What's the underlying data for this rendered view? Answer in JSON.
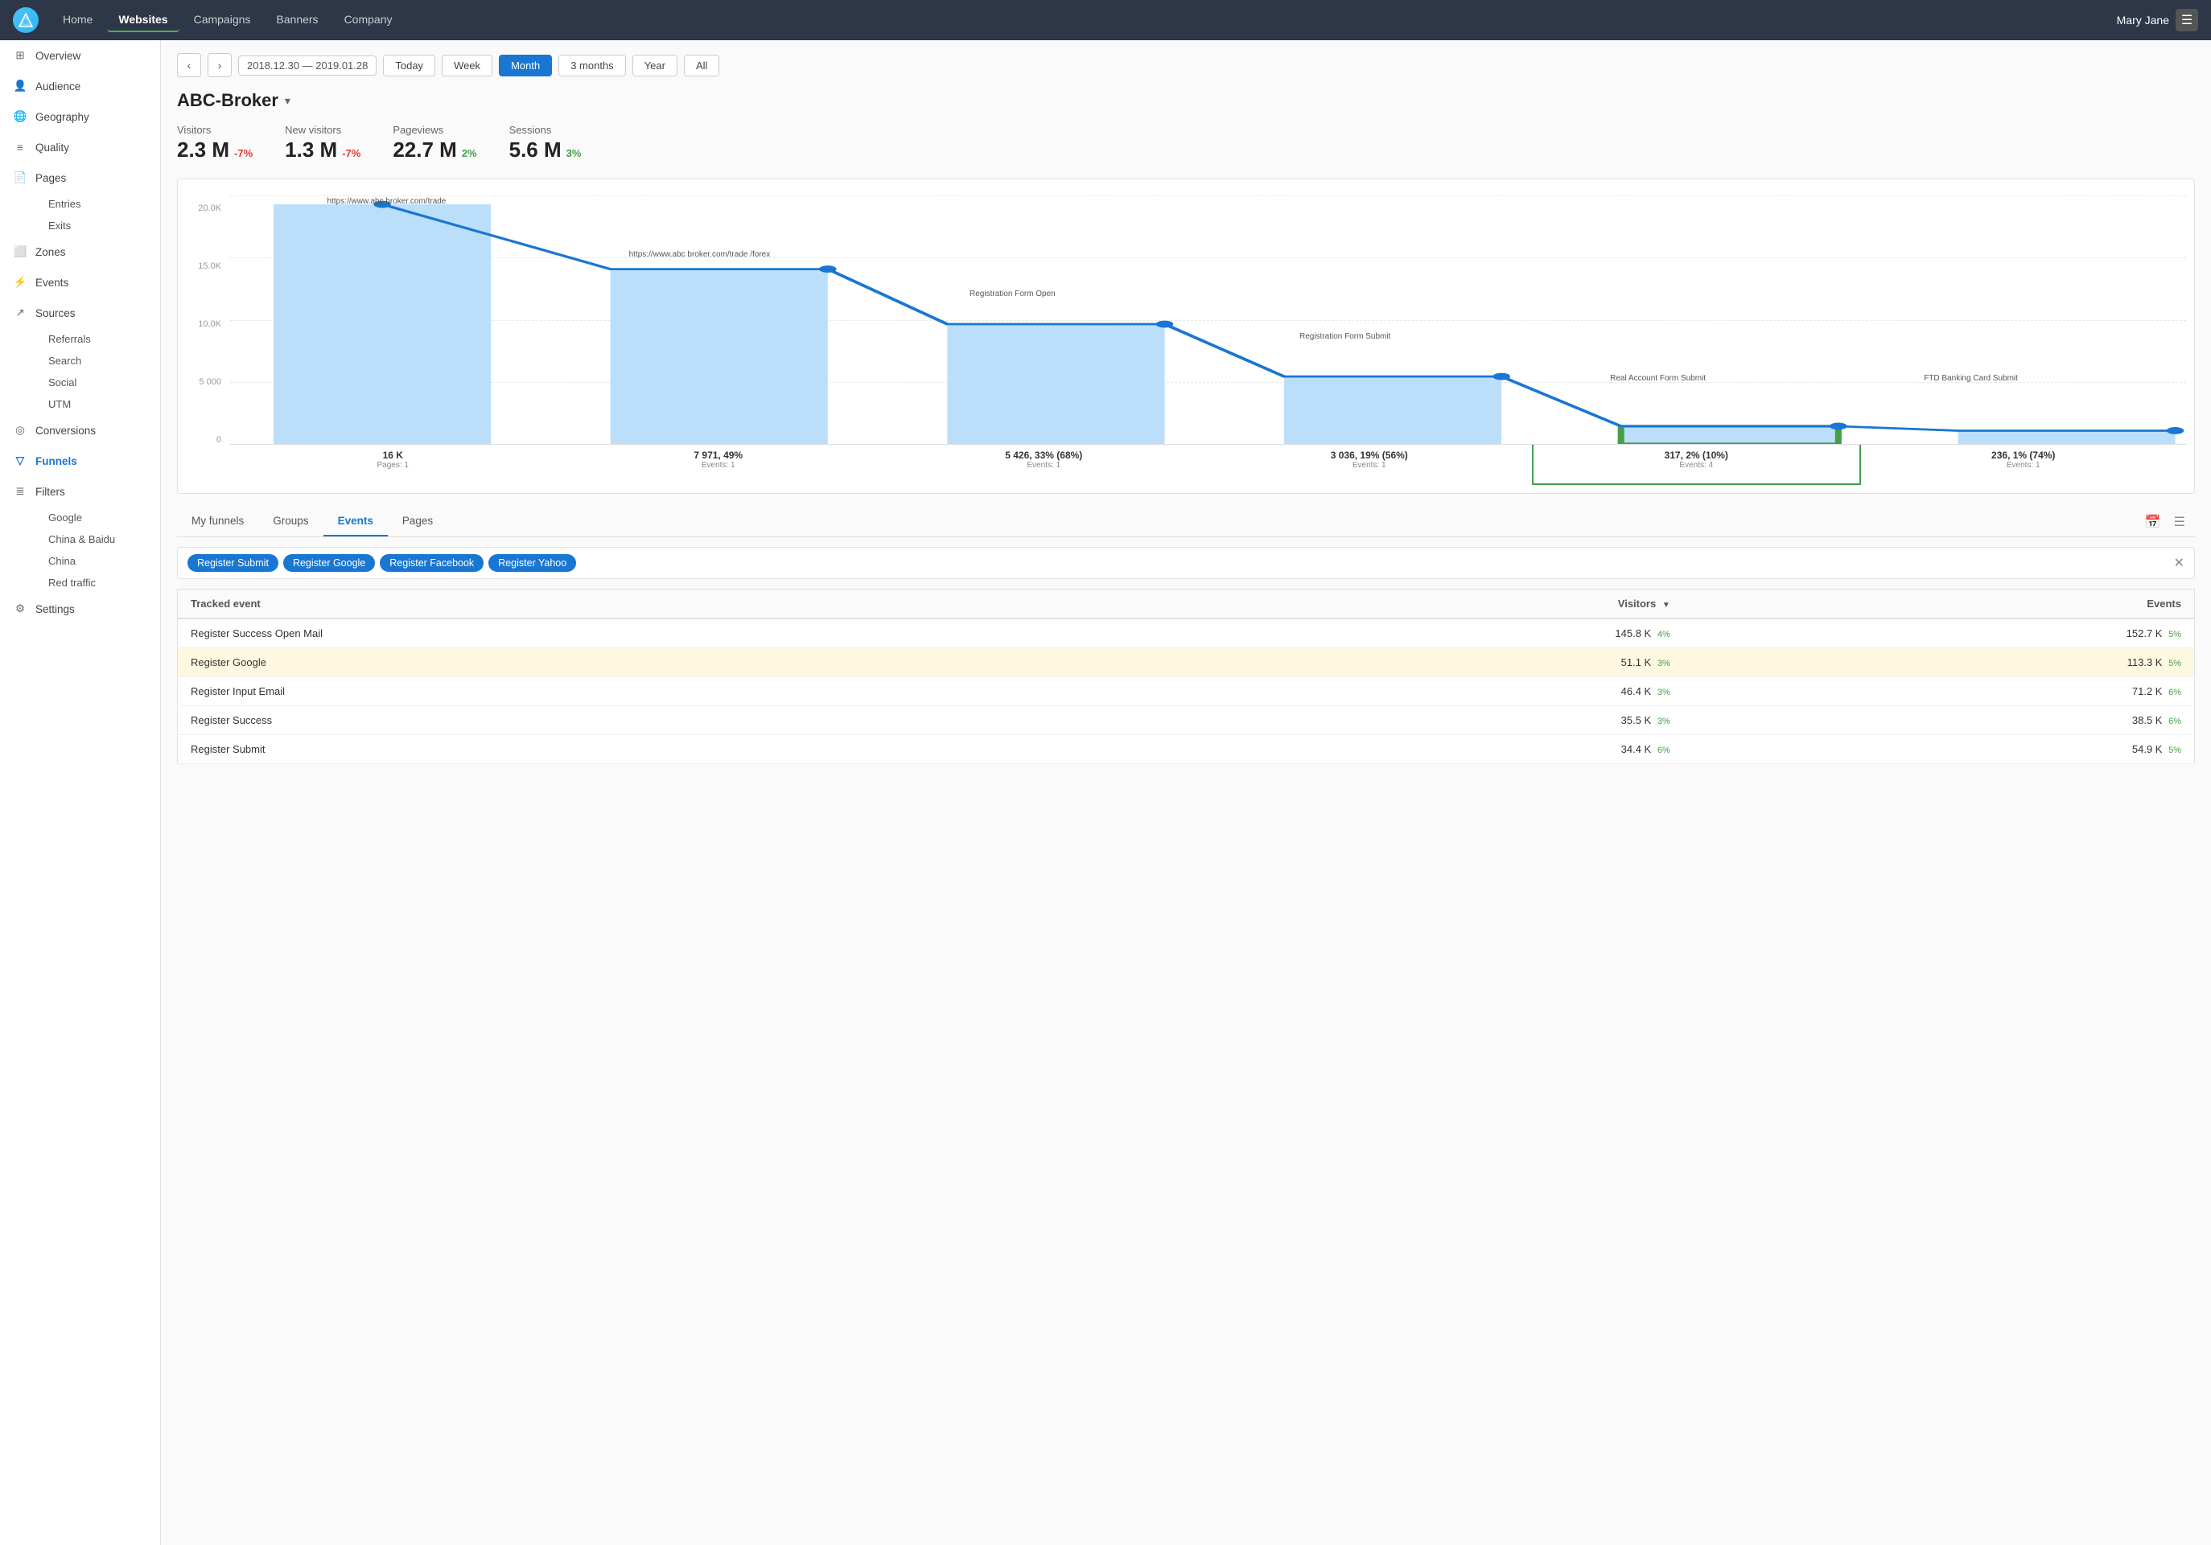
{
  "topNav": {
    "links": [
      {
        "label": "Home",
        "active": false
      },
      {
        "label": "Websites",
        "active": true
      },
      {
        "label": "Campaigns",
        "active": false
      },
      {
        "label": "Banners",
        "active": false
      },
      {
        "label": "Company",
        "active": false
      }
    ],
    "user": "Mary Jane"
  },
  "sidebar": {
    "items": [
      {
        "label": "Overview",
        "icon": "grid",
        "active": false,
        "sub": []
      },
      {
        "label": "Audience",
        "icon": "people",
        "active": false,
        "sub": []
      },
      {
        "label": "Geography",
        "icon": "globe",
        "active": false,
        "sub": []
      },
      {
        "label": "Quality",
        "icon": "sliders",
        "active": false,
        "sub": []
      },
      {
        "label": "Pages",
        "icon": "file",
        "active": false,
        "sub": [
          "Entries",
          "Exits"
        ]
      },
      {
        "label": "Zones",
        "icon": "layers",
        "active": false,
        "sub": []
      },
      {
        "label": "Events",
        "icon": "zap",
        "active": false,
        "sub": []
      },
      {
        "label": "Sources",
        "icon": "share",
        "active": false,
        "sub": [
          "Referrals",
          "Search",
          "Social",
          "UTM"
        ]
      },
      {
        "label": "Conversions",
        "icon": "target",
        "active": false,
        "sub": []
      },
      {
        "label": "Funnels",
        "icon": "filter",
        "active": true,
        "sub": []
      },
      {
        "label": "Filters",
        "icon": "filter2",
        "active": false,
        "sub": [
          "Google",
          "China & Baidu",
          "China",
          "Red traffic"
        ]
      },
      {
        "label": "Settings",
        "icon": "settings",
        "active": false,
        "sub": []
      }
    ]
  },
  "datebar": {
    "dateRange": "2018.12.30 — 2019.01.28",
    "periods": [
      "Today",
      "Week",
      "Month",
      "3 months",
      "Year",
      "All"
    ],
    "activePeriod": "Month"
  },
  "site": {
    "name": "ABC-Broker"
  },
  "metrics": [
    {
      "label": "Visitors",
      "value": "2.3 M",
      "change": "-7%",
      "type": "neg"
    },
    {
      "label": "New visitors",
      "value": "1.3 M",
      "change": "-7%",
      "type": "neg"
    },
    {
      "label": "Pageviews",
      "value": "22.7 M",
      "change": "2%",
      "type": "pos"
    },
    {
      "label": "Sessions",
      "value": "5.6 M",
      "change": "3%",
      "type": "pos"
    }
  ],
  "funnelChart": {
    "yLabels": [
      "20.0K",
      "15.0K",
      "10.0K",
      "5 000",
      "0"
    ],
    "steps": [
      {
        "label": "https://www.abc broker.com/trade",
        "barHeight": 270,
        "infoMain": "16 K",
        "infoSub": "Pages: 1",
        "highlighted": false
      },
      {
        "label": "https://www.abc broker.com/trade /forex",
        "barHeight": 197,
        "infoMain": "7 971, 49%",
        "infoSub": "Events: 1",
        "highlighted": false
      },
      {
        "label": "Registration Form Open",
        "barHeight": 135,
        "infoMain": "5 426, 33% (68%)",
        "infoSub": "Events: 1",
        "highlighted": false
      },
      {
        "label": "Registration Form Submit",
        "barHeight": 76,
        "infoMain": "3 036, 19% (56%)",
        "infoSub": "Events: 1",
        "highlighted": false
      },
      {
        "label": "Real Account Form Submit",
        "barHeight": 20,
        "infoMain": "317, 2% (10%)",
        "infoSub": "Events: 4",
        "highlighted": true
      },
      {
        "label": "FTD Banking Card Submit",
        "barHeight": 15,
        "infoMain": "236, 1% (74%)",
        "infoSub": "Events: 1",
        "highlighted": false
      }
    ]
  },
  "funnelTabs": {
    "tabs": [
      "My funnels",
      "Groups",
      "Events",
      "Pages"
    ],
    "activeTab": "Events"
  },
  "filterTags": [
    "Register Submit",
    "Register Google",
    "Register Facebook",
    "Register Yahoo"
  ],
  "eventsTable": {
    "columns": [
      "Tracked event",
      "Visitors",
      "Events"
    ],
    "rows": [
      {
        "event": "Register Success Open Mail",
        "visitors": "145.8 K",
        "visitorsChange": "4%",
        "visitorsChangeType": "pos",
        "events": "152.7 K",
        "eventsChange": "5%",
        "eventsChangeType": "pos",
        "highlighted": false
      },
      {
        "event": "Register Google",
        "visitors": "51.1 K",
        "visitorsChange": "3%",
        "visitorsChangeType": "pos",
        "events": "113.3 K",
        "eventsChange": "5%",
        "eventsChangeType": "pos",
        "highlighted": true
      },
      {
        "event": "Register Input Email",
        "visitors": "46.4 K",
        "visitorsChange": "3%",
        "visitorsChangeType": "pos",
        "events": "71.2 K",
        "eventsChange": "6%",
        "eventsChangeType": "pos",
        "highlighted": false
      },
      {
        "event": "Register Success",
        "visitors": "35.5 K",
        "visitorsChange": "3%",
        "visitorsChangeType": "pos",
        "events": "38.5 K",
        "eventsChange": "6%",
        "eventsChangeType": "pos",
        "highlighted": false
      },
      {
        "event": "Register Submit",
        "visitors": "34.4 K",
        "visitorsChange": "6%",
        "visitorsChangeType": "pos",
        "events": "54.9 K",
        "eventsChange": "5%",
        "eventsChangeType": "pos",
        "highlighted": false
      }
    ]
  }
}
